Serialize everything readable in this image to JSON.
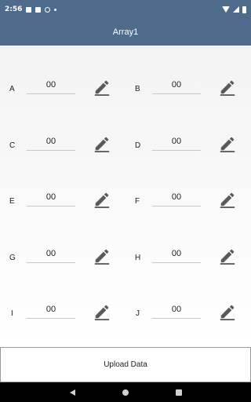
{
  "status_bar": {
    "time": "2:56",
    "icons": [
      "sim-card-icon",
      "square-icon",
      "circle-icon",
      "dot-icon",
      "wifi-icon",
      "signal-icon",
      "battery-icon"
    ]
  },
  "app_bar": {
    "title": "Array1"
  },
  "grid": {
    "cells": [
      {
        "label": "A",
        "value": "00"
      },
      {
        "label": "B",
        "value": "00"
      },
      {
        "label": "C",
        "value": "00"
      },
      {
        "label": "D",
        "value": "00"
      },
      {
        "label": "E",
        "value": "00"
      },
      {
        "label": "F",
        "value": "00"
      },
      {
        "label": "G",
        "value": "00"
      },
      {
        "label": "H",
        "value": "00"
      },
      {
        "label": "I",
        "value": "00"
      },
      {
        "label": "J",
        "value": "00"
      }
    ]
  },
  "upload": {
    "label": "Upload Data"
  },
  "colors": {
    "app_bar": "#4f6b8c",
    "icon": "#5a5a5a"
  }
}
